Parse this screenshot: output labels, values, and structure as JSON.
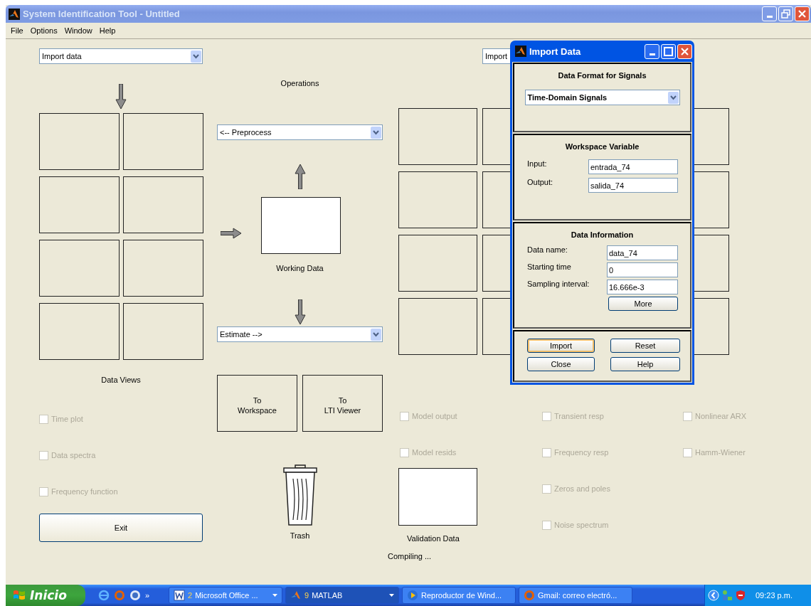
{
  "window": {
    "title": "System Identification Tool - Untitled"
  },
  "menu": [
    "File",
    "Options",
    "Window",
    "Help"
  ],
  "data_panel": {
    "dropdown": "Import data",
    "label": "Data Views",
    "views": [
      {
        "label": "Time plot",
        "checked": false,
        "disabled": true
      },
      {
        "label": "Data spectra",
        "checked": false,
        "disabled": true
      },
      {
        "label": "Frequency function",
        "checked": false,
        "disabled": true
      }
    ]
  },
  "exit_button": "Exit",
  "operations": {
    "title": "Operations",
    "preprocess": "<-- Preprocess",
    "working_data": "Working Data",
    "estimate": "Estimate -->",
    "buttons": [
      {
        "lines": [
          "To",
          "Workspace"
        ]
      },
      {
        "lines": [
          "To",
          "LTI Viewer"
        ]
      }
    ],
    "trash": "Trash"
  },
  "model_panel": {
    "dropdown": "Import",
    "validation_data": "Validation Data",
    "view_columns": [
      [
        {
          "label": "Model output",
          "checked": false,
          "disabled": true
        },
        {
          "label": "Model resids",
          "checked": false,
          "disabled": true
        }
      ],
      [
        {
          "label": "Transient resp",
          "checked": false,
          "disabled": true
        },
        {
          "label": "Frequency resp",
          "checked": false,
          "disabled": true
        },
        {
          "label": "Zeros and poles",
          "checked": false,
          "disabled": true
        },
        {
          "label": "Noise spectrum",
          "checked": false,
          "disabled": true
        }
      ],
      [
        {
          "label": "Nonlinear ARX",
          "checked": false,
          "disabled": true
        },
        {
          "label": "Hamm-Wiener",
          "checked": false,
          "disabled": true
        }
      ]
    ]
  },
  "status": "Compiling ...",
  "dialog": {
    "title": "Import Data",
    "format": {
      "heading": "Data Format for Signals",
      "value": "Time-Domain Signals"
    },
    "workspace": {
      "heading": "Workspace Variable",
      "fields": [
        {
          "label": "Input:",
          "value": "entrada_74"
        },
        {
          "label": "Output:",
          "value": "salida_74"
        }
      ]
    },
    "info": {
      "heading": "Data Information",
      "fields": [
        {
          "label": "Data name:",
          "value": "data_74"
        },
        {
          "label": "Starting time",
          "value": "0"
        },
        {
          "label": "Sampling interval:",
          "value": "16.666e-3"
        }
      ],
      "more_button": "More"
    },
    "buttons": [
      {
        "label": "Import",
        "focused": true
      },
      {
        "label": "Reset",
        "focused": false
      },
      {
        "label": "Close",
        "focused": false
      },
      {
        "label": "Help",
        "focused": false
      }
    ]
  },
  "taskbar": {
    "start": "Inicio",
    "overflow": "»",
    "tasks": [
      {
        "kind": "word",
        "count": "2",
        "label": "Microsoft Office ...",
        "group": true,
        "active": false
      },
      {
        "kind": "matlab",
        "count": "9",
        "label": "MATLAB",
        "group": true,
        "active": true
      },
      {
        "kind": "media",
        "label": "Reproductor de Wind...",
        "group": false,
        "active": false
      },
      {
        "kind": "browser",
        "label": "Gmail: correo electró...",
        "group": false,
        "active": false
      }
    ],
    "clock": "09:23 p.m."
  }
}
